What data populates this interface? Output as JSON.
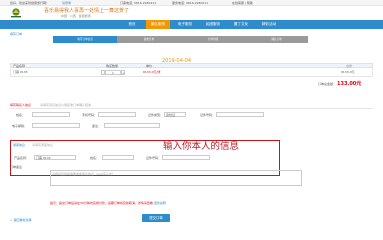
{
  "topbar": {
    "welcome": "您好，欢迎来到健康旅行网！",
    "login": "请登录",
    "hotline1_label": "订票电话：",
    "hotline1": "0816-2280211",
    "hotline2_label": "服务电话：",
    "hotline2": "0816-2280211",
    "links": "在线客服 | 帮助"
  },
  "header": {
    "logo_text": "四联旅游",
    "slogan": "喜乐易得我人喜再一处情上一舞这贺了",
    "subslogan": "中国 · 川西 · 健康旅游"
  },
  "nav": {
    "items": [
      "首页",
      "景区服务",
      "电子服务",
      "民团服务",
      "置丁文化",
      "精彩活动"
    ]
  },
  "breadcrumb": "填写订单",
  "steps": [
    "填写订单信息",
    "提交订单",
    "订单付款",
    "确认订单"
  ],
  "order": {
    "date": "2019-04-04",
    "columns": [
      "产品名称",
      "购买数量",
      "单价",
      "小计"
    ],
    "product": "门票 ¥133",
    "qty": "1",
    "price": "¥133.0元/张",
    "subtotal": "¥133.0元",
    "total_label": "订单总金额：",
    "total": "133.00元"
  },
  "section_contact": "填写联系人信息",
  "section_contact_note": "请填写真实信息以便接收订单确认短信",
  "contact": {
    "name_label": "姓名：",
    "phone_label": "手机号码：",
    "id_label": "证件类型：",
    "id_select": "身份证",
    "id_num_label": "证件号码：",
    "email_label": "电子邮箱：",
    "remark_label": "备注："
  },
  "section_visitor": "游客信息",
  "visitor": {
    "note": "请填写游客信息",
    "product_label": "产品名称：",
    "product_value": "门票 ¥133",
    "name_label": "姓名：",
    "id_label": "证件号码："
  },
  "annotation": "输入你本人的信息",
  "section_remark": "订单备注",
  "remark_placeholder": "请填写您的特殊要求或备注信息（200字以内）",
  "notice": {
    "text": "提示：提交订单后请在30分钟内完成付款，逾期订单将自动取消，详情请查看",
    "link": "退款说明"
  },
  "back_link": "< 返回重新选择",
  "submit_label": "提交订单"
}
